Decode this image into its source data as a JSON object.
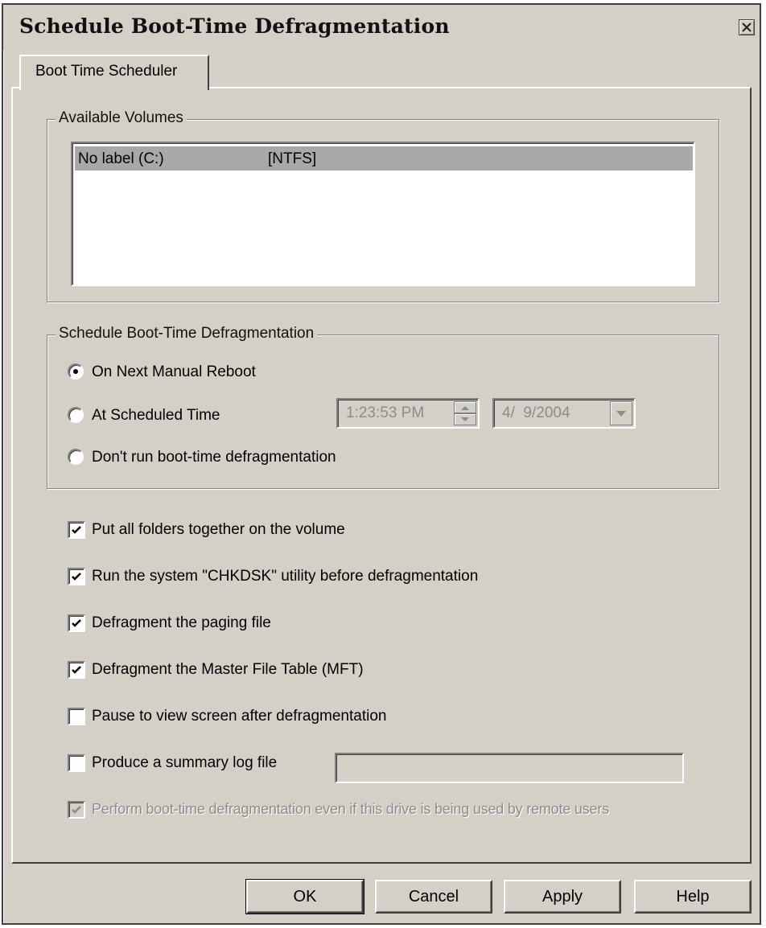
{
  "window": {
    "title": "Schedule Boot-Time Defragmentation",
    "close_icon": "close-icon"
  },
  "tabs": [
    {
      "label": "Boot Time Scheduler",
      "active": true
    }
  ],
  "volumes": {
    "legend": "Available Volumes",
    "items": [
      {
        "name": "No label (C:)",
        "fs": "[NTFS]",
        "selected": true
      }
    ]
  },
  "schedule": {
    "legend": "Schedule Boot-Time Defragmentation",
    "options": [
      {
        "label": "On Next Manual Reboot",
        "checked": true
      },
      {
        "label": "At Scheduled Time",
        "checked": false
      },
      {
        "label": "Don't run boot-time defragmentation",
        "checked": false
      }
    ],
    "time_value": "1:23:53 PM",
    "date_value": "4/  9/2004"
  },
  "options": [
    {
      "label": "Put all folders together on the volume",
      "checked": true,
      "enabled": true
    },
    {
      "label": "Run the system \"CHKDSK\" utility before defragmentation",
      "checked": true,
      "enabled": true
    },
    {
      "label": "Defragment the paging file",
      "checked": true,
      "enabled": true
    },
    {
      "label": "Defragment the Master File Table (MFT)",
      "checked": true,
      "enabled": true
    },
    {
      "label": "Pause to view screen after defragmentation",
      "checked": false,
      "enabled": true
    },
    {
      "label": "Produce a summary log file",
      "checked": false,
      "enabled": true
    },
    {
      "label": "Perform boot-time defragmentation even if this drive is being used by remote users",
      "checked": true,
      "enabled": false
    }
  ],
  "log_file_path": "",
  "buttons": {
    "ok": "OK",
    "cancel": "Cancel",
    "apply": "Apply",
    "help": "Help"
  },
  "colors": {
    "face": "#d4d0c8",
    "selection": "#a8a8a8",
    "disabled_text": "#8c8c8c"
  }
}
